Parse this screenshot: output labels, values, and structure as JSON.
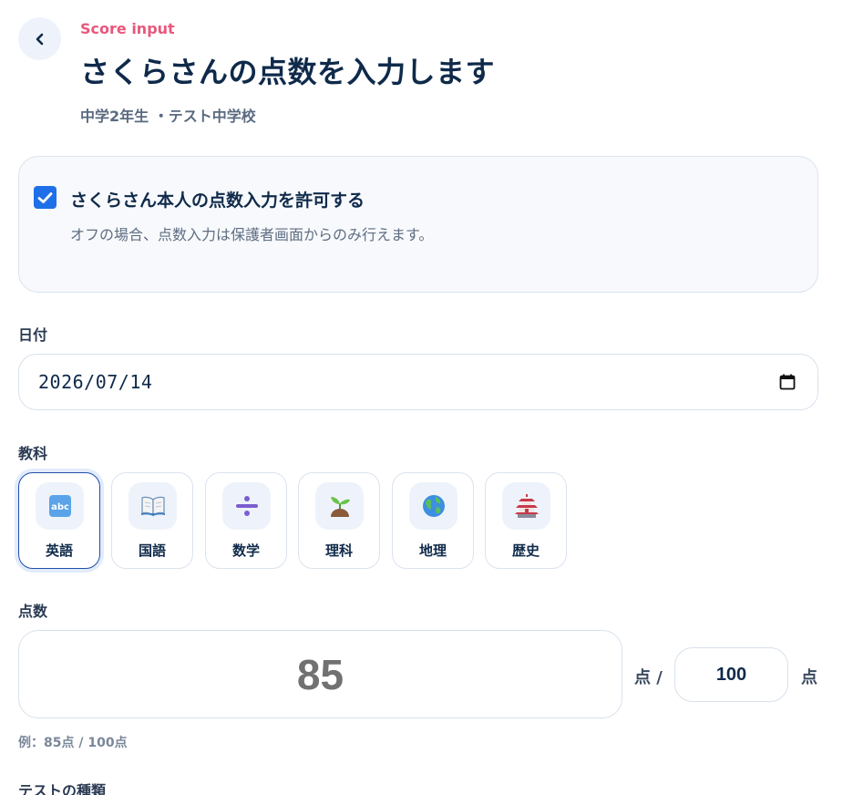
{
  "header": {
    "back_icon": "chevron-left-icon",
    "eyebrow": "Score input",
    "title": "さくらさんの点数を入力します",
    "subtitle": "中学2年生 ・テスト中学校"
  },
  "permission": {
    "checked": true,
    "label": "さくらさん本人の点数入力を許可する",
    "description": "オフの場合、点数入力は保護者画面からのみ行えます。"
  },
  "date": {
    "label": "日付",
    "value": "2026/07/14",
    "icon": "calendar-icon"
  },
  "subject": {
    "label": "教科",
    "selected": "英語",
    "items": [
      {
        "label": "英語",
        "icon": "abc-icon"
      },
      {
        "label": "国語",
        "icon": "open-book-icon"
      },
      {
        "label": "数学",
        "icon": "divide-icon"
      },
      {
        "label": "理科",
        "icon": "seedling-icon"
      },
      {
        "label": "地理",
        "icon": "globe-icon"
      },
      {
        "label": "歴史",
        "icon": "castle-icon"
      }
    ]
  },
  "score": {
    "label": "点数",
    "value": "85",
    "unit_between": "点 /",
    "max_value": "100",
    "unit_after": "点",
    "hint": "例：85点 / 100点"
  },
  "test_type": {
    "label": "テストの種類"
  },
  "colors": {
    "accent": "#1f6fe8",
    "eyebrow": "#e8577c",
    "title": "#0f2a4a"
  }
}
